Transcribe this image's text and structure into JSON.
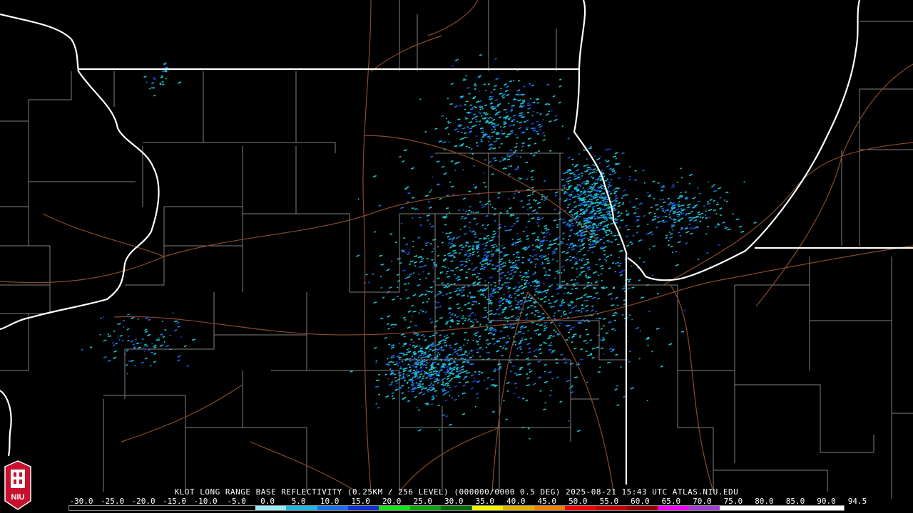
{
  "product": {
    "caption": "KLOT LONG RANGE BASE REFLECTIVITY (0.25KM / 256 LEVEL) (000000/0000 0.5 DEG) 2025-08-21 15:43 UTC  ATLAS.NIU.EDU"
  },
  "logo": {
    "text": "NIU",
    "color": "#c8102e"
  },
  "colors": {
    "state_borders": "#ffffff",
    "county_lines": "#808080",
    "highways": "#8b4a2b",
    "echo_light": "#19c8d2",
    "echo_mid": "#1e6ee6",
    "echo_strong": "#1b3ccf"
  },
  "scale": {
    "labels": [
      "-30.0",
      "-25.0",
      "-20.0",
      "-15.0",
      "-10.0",
      "-5.0",
      "0.0",
      "5.0",
      "10.0",
      "15.0",
      "20.0",
      "25.0",
      "30.0",
      "35.0",
      "40.0",
      "45.0",
      "50.0",
      "55.0",
      "60.0",
      "65.0",
      "70.0",
      "75.0",
      "80.0",
      "85.0",
      "90.0",
      "94.5"
    ],
    "segment_colors": [
      "#000000",
      "#000000",
      "#000000",
      "#000000",
      "#000000",
      "#000000",
      "#9ce8f0",
      "#22b5e0",
      "#1e6ee6",
      "#1530c8",
      "#18e018",
      "#10a010",
      "#0a6a0a",
      "#f0f000",
      "#e0b000",
      "#f08000",
      "#f00000",
      "#c00000",
      "#900000",
      "#f000f0",
      "#a040d0",
      "#ffffff",
      "#ffffff",
      "#ffffff",
      "#ffffff"
    ]
  }
}
